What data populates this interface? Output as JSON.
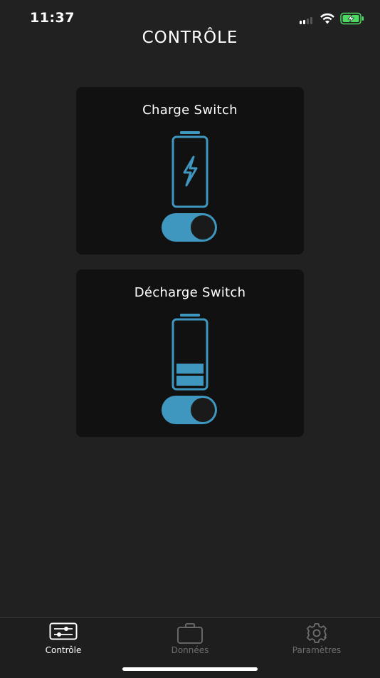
{
  "status_bar": {
    "time": "11:37",
    "signal_icon": "cellular-signal-icon",
    "wifi_icon": "wifi-icon",
    "battery_icon": "battery-charging-icon"
  },
  "header": {
    "title": "CONTRÔLE"
  },
  "cards": [
    {
      "title": "Charge Switch",
      "icon": "battery-charging-icon",
      "toggle_on": true
    },
    {
      "title": "Décharge Switch",
      "icon": "battery-discharging-icon",
      "toggle_on": true
    }
  ],
  "tabs": [
    {
      "label": "Contrôle",
      "icon": "sliders-icon",
      "active": true
    },
    {
      "label": "Données",
      "icon": "briefcase-icon",
      "active": false
    },
    {
      "label": "Paramètres",
      "icon": "gear-icon",
      "active": false
    }
  ],
  "colors": {
    "background": "#212121",
    "card": "#111111",
    "accent": "#3f97bf",
    "battery_green": "#4cd964"
  }
}
